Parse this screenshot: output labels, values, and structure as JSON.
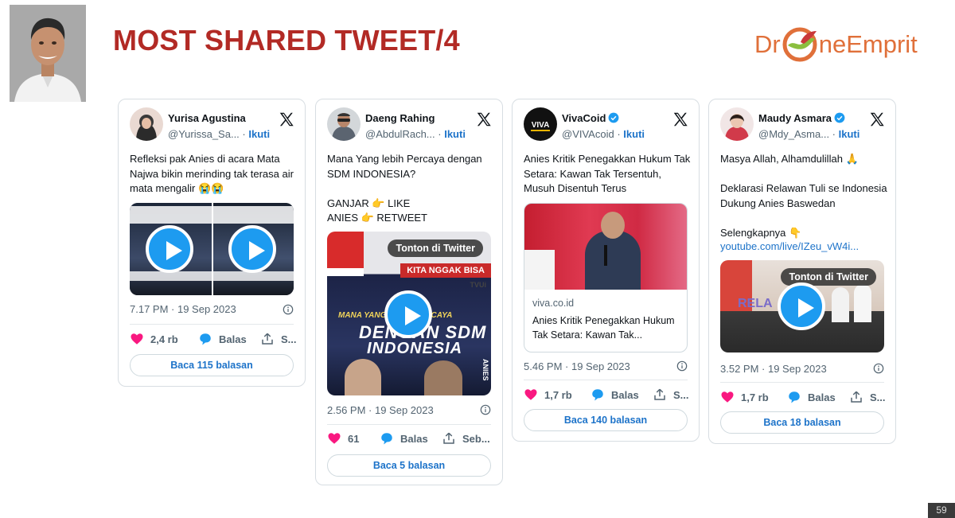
{
  "slide": {
    "title": "MOST SHARED TWEET/4",
    "logo": {
      "part1": "Dr",
      "part2": "neEmprit"
    },
    "page_number": "59"
  },
  "tweets": [
    {
      "author": "Yurisa Agustina",
      "handle": "@Yurissa_Sa...",
      "follow": "Ikuti",
      "text": "Refleksi pak Anies di acara Mata Najwa bikin merinding tak terasa air mata mengalir 😭😭",
      "time": "7.17 PM · 19 Sep 2023",
      "likes": "2,4 rb",
      "reply_label": "Balas",
      "share_label": "S...",
      "read_label": "Baca 115 balasan"
    },
    {
      "author": "Daeng Rahing",
      "handle": "@AbdulRach...",
      "follow": "Ikuti",
      "text": "Mana Yang lebih Percaya dengan SDM INDONESIA?\n\nGANJAR 👉 LIKE\nANIES    👉 RETWEET",
      "media": {
        "badge": "Tonton di Twitter",
        "banner": "KITA NGGAK BISA",
        "line1": "MANA YANG LEBIH PERCAYA",
        "line2": "DENGAN SDM",
        "line3": "INDONESIA",
        "side": "ANIES",
        "channel": "TVUi"
      },
      "time": "2.56 PM · 19 Sep 2023",
      "likes": "61",
      "reply_label": "Balas",
      "share_label": "Seb...",
      "read_label": "Baca 5 balasan"
    },
    {
      "author": "VivaCoid",
      "handle": "@VIVAcoid",
      "follow": "Ikuti",
      "text": "Anies Kritik Penegakkan Hukum Tak Setara: Kawan Tak Tersentuh, Musuh Disentuh Terus",
      "link_domain": "viva.co.id",
      "link_title": "Anies Kritik Penegakkan Hukum Tak Setara: Kawan Tak...",
      "time": "5.46 PM · 19 Sep 2023",
      "likes": "1,7 rb",
      "reply_label": "Balas",
      "share_label": "S...",
      "read_label": "Baca 140 balasan"
    },
    {
      "author": "Maudy Asmara",
      "handle": "@Mdy_Asma...",
      "follow": "Ikuti",
      "text": "Masya Allah, Alhamdulillah 🙏\n\nDeklarasi Relawan Tuli se Indonesia Dukung Anies Baswedan\n\nSelengkapnya 👇",
      "link": "youtube.com/live/IZeu_vW4i...",
      "media": {
        "badge": "Tonton di Twitter",
        "sign": "RELA"
      },
      "time": "3.52 PM · 19 Sep 2023",
      "likes": "1,7 rb",
      "reply_label": "Balas",
      "share_label": "S...",
      "read_label": "Baca 18 balasan"
    }
  ],
  "colors": {
    "title": "#b22a25",
    "logo": "#e0703a",
    "link": "#1d73c9",
    "like": "#f91880",
    "reply": "#1d9bf0"
  }
}
